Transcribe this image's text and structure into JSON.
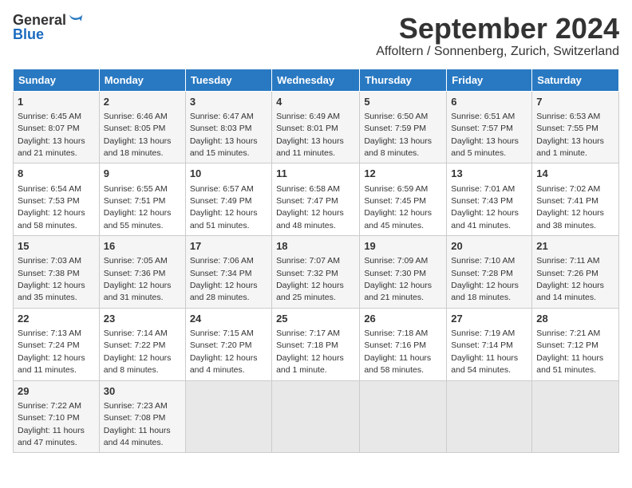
{
  "header": {
    "logo_general": "General",
    "logo_blue": "Blue",
    "month_title": "September 2024",
    "location": "Affoltern / Sonnenberg, Zurich, Switzerland"
  },
  "days_of_week": [
    "Sunday",
    "Monday",
    "Tuesday",
    "Wednesday",
    "Thursday",
    "Friday",
    "Saturday"
  ],
  "weeks": [
    [
      {
        "day": "1",
        "sunrise": "Sunrise: 6:45 AM",
        "sunset": "Sunset: 8:07 PM",
        "daylight": "Daylight: 13 hours and 21 minutes."
      },
      {
        "day": "2",
        "sunrise": "Sunrise: 6:46 AM",
        "sunset": "Sunset: 8:05 PM",
        "daylight": "Daylight: 13 hours and 18 minutes."
      },
      {
        "day": "3",
        "sunrise": "Sunrise: 6:47 AM",
        "sunset": "Sunset: 8:03 PM",
        "daylight": "Daylight: 13 hours and 15 minutes."
      },
      {
        "day": "4",
        "sunrise": "Sunrise: 6:49 AM",
        "sunset": "Sunset: 8:01 PM",
        "daylight": "Daylight: 13 hours and 11 minutes."
      },
      {
        "day": "5",
        "sunrise": "Sunrise: 6:50 AM",
        "sunset": "Sunset: 7:59 PM",
        "daylight": "Daylight: 13 hours and 8 minutes."
      },
      {
        "day": "6",
        "sunrise": "Sunrise: 6:51 AM",
        "sunset": "Sunset: 7:57 PM",
        "daylight": "Daylight: 13 hours and 5 minutes."
      },
      {
        "day": "7",
        "sunrise": "Sunrise: 6:53 AM",
        "sunset": "Sunset: 7:55 PM",
        "daylight": "Daylight: 13 hours and 1 minute."
      }
    ],
    [
      {
        "day": "8",
        "sunrise": "Sunrise: 6:54 AM",
        "sunset": "Sunset: 7:53 PM",
        "daylight": "Daylight: 12 hours and 58 minutes."
      },
      {
        "day": "9",
        "sunrise": "Sunrise: 6:55 AM",
        "sunset": "Sunset: 7:51 PM",
        "daylight": "Daylight: 12 hours and 55 minutes."
      },
      {
        "day": "10",
        "sunrise": "Sunrise: 6:57 AM",
        "sunset": "Sunset: 7:49 PM",
        "daylight": "Daylight: 12 hours and 51 minutes."
      },
      {
        "day": "11",
        "sunrise": "Sunrise: 6:58 AM",
        "sunset": "Sunset: 7:47 PM",
        "daylight": "Daylight: 12 hours and 48 minutes."
      },
      {
        "day": "12",
        "sunrise": "Sunrise: 6:59 AM",
        "sunset": "Sunset: 7:45 PM",
        "daylight": "Daylight: 12 hours and 45 minutes."
      },
      {
        "day": "13",
        "sunrise": "Sunrise: 7:01 AM",
        "sunset": "Sunset: 7:43 PM",
        "daylight": "Daylight: 12 hours and 41 minutes."
      },
      {
        "day": "14",
        "sunrise": "Sunrise: 7:02 AM",
        "sunset": "Sunset: 7:41 PM",
        "daylight": "Daylight: 12 hours and 38 minutes."
      }
    ],
    [
      {
        "day": "15",
        "sunrise": "Sunrise: 7:03 AM",
        "sunset": "Sunset: 7:38 PM",
        "daylight": "Daylight: 12 hours and 35 minutes."
      },
      {
        "day": "16",
        "sunrise": "Sunrise: 7:05 AM",
        "sunset": "Sunset: 7:36 PM",
        "daylight": "Daylight: 12 hours and 31 minutes."
      },
      {
        "day": "17",
        "sunrise": "Sunrise: 7:06 AM",
        "sunset": "Sunset: 7:34 PM",
        "daylight": "Daylight: 12 hours and 28 minutes."
      },
      {
        "day": "18",
        "sunrise": "Sunrise: 7:07 AM",
        "sunset": "Sunset: 7:32 PM",
        "daylight": "Daylight: 12 hours and 25 minutes."
      },
      {
        "day": "19",
        "sunrise": "Sunrise: 7:09 AM",
        "sunset": "Sunset: 7:30 PM",
        "daylight": "Daylight: 12 hours and 21 minutes."
      },
      {
        "day": "20",
        "sunrise": "Sunrise: 7:10 AM",
        "sunset": "Sunset: 7:28 PM",
        "daylight": "Daylight: 12 hours and 18 minutes."
      },
      {
        "day": "21",
        "sunrise": "Sunrise: 7:11 AM",
        "sunset": "Sunset: 7:26 PM",
        "daylight": "Daylight: 12 hours and 14 minutes."
      }
    ],
    [
      {
        "day": "22",
        "sunrise": "Sunrise: 7:13 AM",
        "sunset": "Sunset: 7:24 PM",
        "daylight": "Daylight: 12 hours and 11 minutes."
      },
      {
        "day": "23",
        "sunrise": "Sunrise: 7:14 AM",
        "sunset": "Sunset: 7:22 PM",
        "daylight": "Daylight: 12 hours and 8 minutes."
      },
      {
        "day": "24",
        "sunrise": "Sunrise: 7:15 AM",
        "sunset": "Sunset: 7:20 PM",
        "daylight": "Daylight: 12 hours and 4 minutes."
      },
      {
        "day": "25",
        "sunrise": "Sunrise: 7:17 AM",
        "sunset": "Sunset: 7:18 PM",
        "daylight": "Daylight: 12 hours and 1 minute."
      },
      {
        "day": "26",
        "sunrise": "Sunrise: 7:18 AM",
        "sunset": "Sunset: 7:16 PM",
        "daylight": "Daylight: 11 hours and 58 minutes."
      },
      {
        "day": "27",
        "sunrise": "Sunrise: 7:19 AM",
        "sunset": "Sunset: 7:14 PM",
        "daylight": "Daylight: 11 hours and 54 minutes."
      },
      {
        "day": "28",
        "sunrise": "Sunrise: 7:21 AM",
        "sunset": "Sunset: 7:12 PM",
        "daylight": "Daylight: 11 hours and 51 minutes."
      }
    ],
    [
      {
        "day": "29",
        "sunrise": "Sunrise: 7:22 AM",
        "sunset": "Sunset: 7:10 PM",
        "daylight": "Daylight: 11 hours and 47 minutes."
      },
      {
        "day": "30",
        "sunrise": "Sunrise: 7:23 AM",
        "sunset": "Sunset: 7:08 PM",
        "daylight": "Daylight: 11 hours and 44 minutes."
      },
      null,
      null,
      null,
      null,
      null
    ]
  ]
}
